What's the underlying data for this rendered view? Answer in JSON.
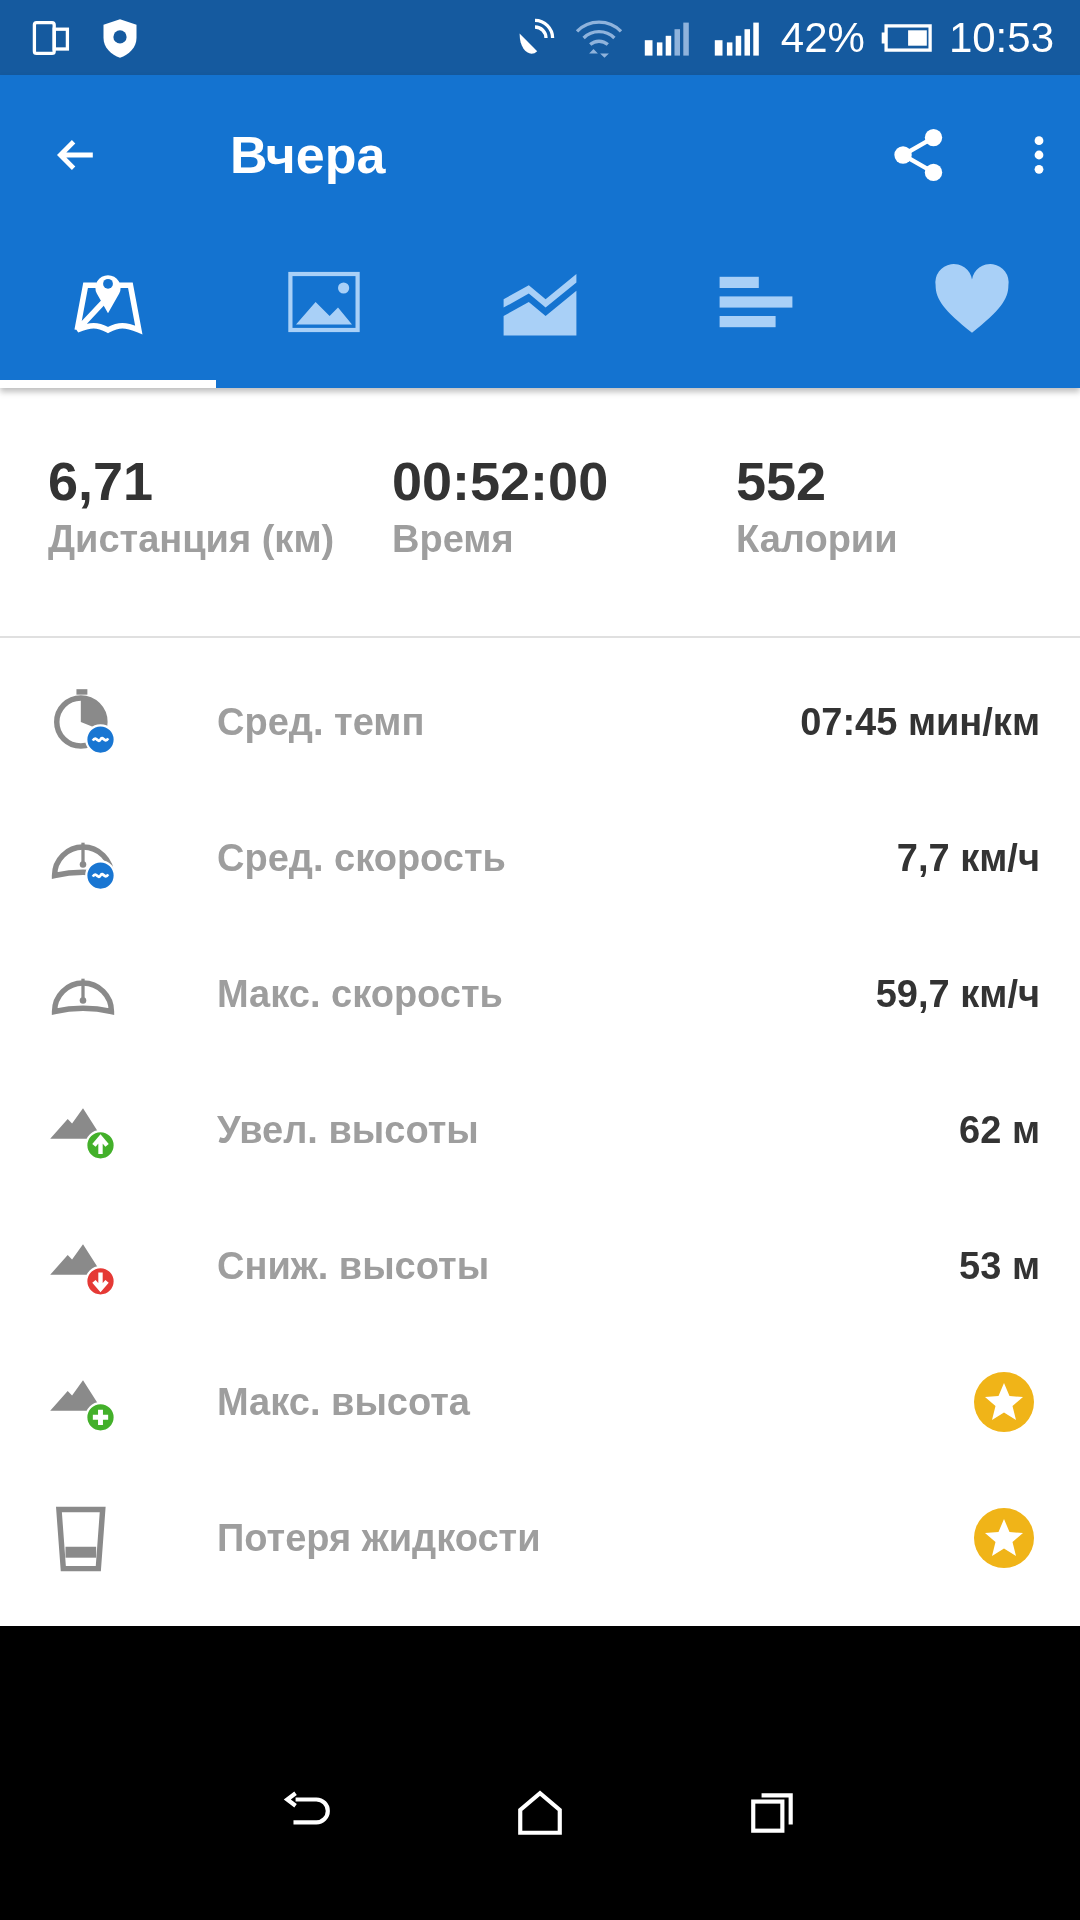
{
  "status_bar": {
    "battery": "42%",
    "time": "10:53"
  },
  "app_bar": {
    "title": "Вчера"
  },
  "tabs": [
    {
      "kind": "map",
      "selected": true
    },
    {
      "kind": "photo",
      "selected": false
    },
    {
      "kind": "chart",
      "selected": false
    },
    {
      "kind": "bars",
      "selected": false
    },
    {
      "kind": "heart",
      "selected": false
    }
  ],
  "summary": [
    {
      "value": "6,71",
      "label": "Дистанция (км)"
    },
    {
      "value": "00:52:00",
      "label": "Время"
    },
    {
      "value": "552",
      "label": "Калории"
    }
  ],
  "metrics": [
    {
      "kind": "pace",
      "label": "Сред. темп",
      "value": "07:45 мин/км"
    },
    {
      "kind": "avg-speed",
      "label": "Сред. скорость",
      "value": "7,7 км/ч"
    },
    {
      "kind": "max-speed",
      "label": "Макс. скорость",
      "value": "59,7 км/ч"
    },
    {
      "kind": "gain",
      "label": "Увел. высоты",
      "value": "62 м"
    },
    {
      "kind": "loss",
      "label": "Сниж. высоты",
      "value": "53 м"
    },
    {
      "kind": "max-alt",
      "label": "Макс. высота",
      "premium": true
    },
    {
      "kind": "fluid",
      "label": "Потеря жидкости",
      "premium": true
    }
  ]
}
